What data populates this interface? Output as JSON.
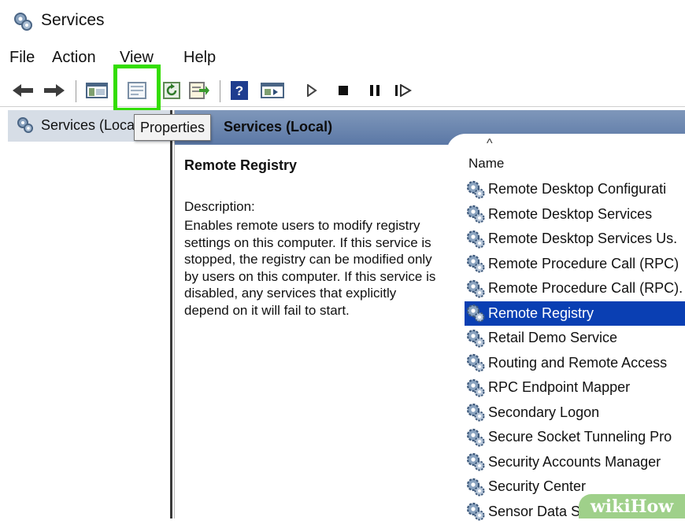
{
  "window": {
    "title": "Services"
  },
  "menu": [
    "File",
    "Action",
    "View",
    "Help"
  ],
  "toolbar": {
    "buttons": [
      "back-arrow-icon",
      "forward-arrow-icon",
      "console-tree-icon",
      "properties-icon",
      "refresh-icon",
      "export-list-icon",
      "help-icon",
      "console-view-icon",
      "play-icon",
      "stop-icon",
      "pause-icon",
      "resume-icon"
    ]
  },
  "tooltip": "Properties",
  "tree": {
    "root": "Services (Local)"
  },
  "detail": {
    "header": "Services (Local)",
    "service_title": "Remote Registry",
    "description_label": "Description:",
    "description": "Enables remote users to modify registry settings on this computer. If this service is stopped, the registry can be modified only by users on this computer. If this service is disabled, any services that explicitly depend on it will fail to start."
  },
  "list": {
    "sort_indicator": "^",
    "column": "Name",
    "items": [
      "Remote Desktop Configurati",
      "Remote Desktop Services",
      "Remote Desktop Services Us.",
      "Remote Procedure Call (RPC)",
      "Remote Procedure Call (RPC).",
      "Remote Registry",
      "Retail Demo Service",
      "Routing and Remote Access",
      "RPC Endpoint Mapper",
      "Secondary Logon",
      "Secure Socket Tunneling Pro",
      "Security Accounts Manager",
      "Security Center",
      "Sensor Data Service"
    ],
    "selected": "Remote Registry"
  },
  "watermark": "wikiHow",
  "colors": {
    "highlight": "#33dd00",
    "selection": "#0a3fb3",
    "header": "#5b78a6"
  }
}
